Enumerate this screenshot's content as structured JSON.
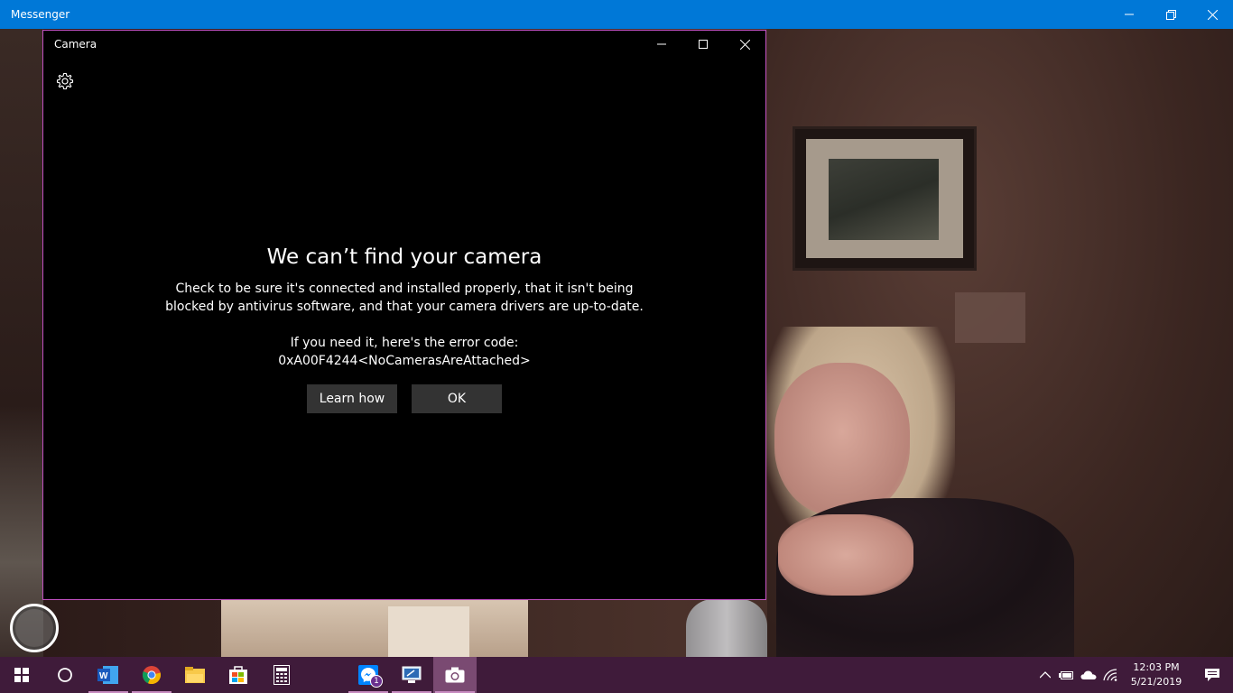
{
  "messenger": {
    "title": "Messenger"
  },
  "camera_window": {
    "title": "Camera",
    "error_title": "We can’t find your camera",
    "body_line1": "Check to be sure it's connected and installed properly, that it isn't being",
    "body_line2": "blocked by antivirus software, and that your camera drivers are up-to-date.",
    "error_intro": "If you need it, here's the error code:",
    "error_code": "0xA00F4244<NoCamerasAreAttached>",
    "learn_how_label": "Learn how",
    "ok_label": "OK"
  },
  "taskbar": {
    "items": [
      "start-icon",
      "search-icon",
      "word-icon",
      "chrome-icon",
      "file-explorer-icon",
      "store-icon",
      "calculator-icon",
      "messenger-icon",
      "remote-desktop-icon",
      "camera-icon"
    ],
    "messenger_badge": "1",
    "time": "12:03 PM",
    "date": "5/21/2019"
  },
  "colors": {
    "messenger_titlebar": "#0078d7",
    "taskbar": "#3f1b3a",
    "camera_border": "#c050c0",
    "button_bg": "#333333"
  }
}
